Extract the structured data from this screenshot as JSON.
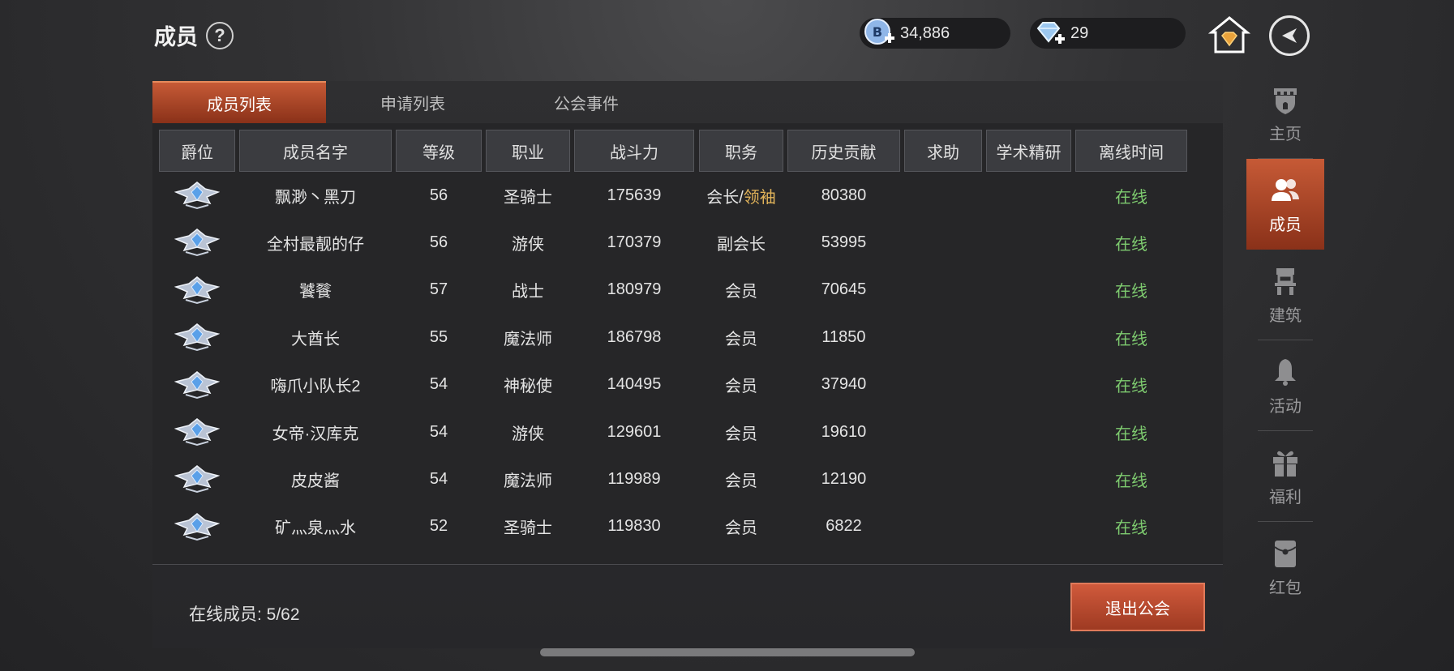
{
  "header": {
    "title": "成员",
    "help": "?"
  },
  "currency": {
    "coins": "34,886",
    "gems": "29"
  },
  "tabs": [
    {
      "label": "成员列表",
      "active": true
    },
    {
      "label": "申请列表",
      "active": false
    },
    {
      "label": "公会事件",
      "active": false
    }
  ],
  "columns": [
    "爵位",
    "成员名字",
    "等级",
    "职业",
    "战斗力",
    "职务",
    "历史贡献",
    "求助",
    "学术精研",
    "离线时间"
  ],
  "members": [
    {
      "name": "飘渺丶黑刀",
      "level": "56",
      "class": "圣骑士",
      "power": "175639",
      "role": "会长/",
      "role_extra": "领袖",
      "contrib": "80380",
      "help": "",
      "study": "",
      "status": "在线"
    },
    {
      "name": "全村最靓的仔",
      "level": "56",
      "class": "游侠",
      "power": "170379",
      "role": "副会长",
      "role_extra": "",
      "contrib": "53995",
      "help": "",
      "study": "",
      "status": "在线"
    },
    {
      "name": "饕餮",
      "level": "57",
      "class": "战士",
      "power": "180979",
      "role": "会员",
      "role_extra": "",
      "contrib": "70645",
      "help": "",
      "study": "",
      "status": "在线"
    },
    {
      "name": "大酋长",
      "level": "55",
      "class": "魔法师",
      "power": "186798",
      "role": "会员",
      "role_extra": "",
      "contrib": "11850",
      "help": "",
      "study": "",
      "status": "在线"
    },
    {
      "name": "嗨爪小队长2",
      "level": "54",
      "class": "神秘使",
      "power": "140495",
      "role": "会员",
      "role_extra": "",
      "contrib": "37940",
      "help": "",
      "study": "",
      "status": "在线"
    },
    {
      "name": "女帝·汉库克",
      "level": "54",
      "class": "游侠",
      "power": "129601",
      "role": "会员",
      "role_extra": "",
      "contrib": "19610",
      "help": "",
      "study": "",
      "status": "在线"
    },
    {
      "name": "皮皮酱",
      "level": "54",
      "class": "魔法师",
      "power": "119989",
      "role": "会员",
      "role_extra": "",
      "contrib": "12190",
      "help": "",
      "study": "",
      "status": "在线"
    },
    {
      "name": "矿灬泉灬水",
      "level": "52",
      "class": "圣骑士",
      "power": "119830",
      "role": "会员",
      "role_extra": "",
      "contrib": "6822",
      "help": "",
      "study": "",
      "status": "在线"
    }
  ],
  "footer": {
    "online_label": "在线成员: 5/62",
    "quit_label": "退出公会"
  },
  "sidebar": [
    {
      "label": "主页",
      "icon": "tower-icon",
      "active": false
    },
    {
      "label": "成员",
      "icon": "members-icon",
      "active": true
    },
    {
      "label": "建筑",
      "icon": "building-icon",
      "active": false
    },
    {
      "label": "活动",
      "icon": "bell-icon",
      "active": false
    },
    {
      "label": "福利",
      "icon": "gift-icon",
      "active": false
    },
    {
      "label": "红包",
      "icon": "red-envelope-icon",
      "active": false
    }
  ],
  "colors": {
    "accent": "#c65a36",
    "online": "#7ecb6f",
    "gold": "#e2b45a"
  }
}
